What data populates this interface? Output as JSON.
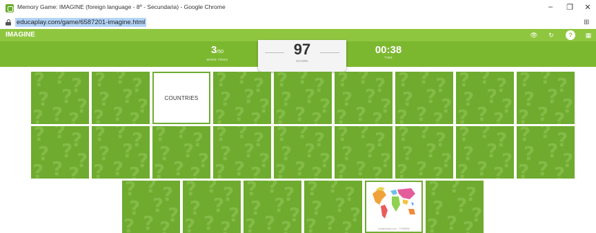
{
  "window": {
    "title": "Memory Game: IMAGINE (foreign language - 8º - Secundaria) - Google Chrome",
    "controls": {
      "minimize": "–",
      "restore": "❐",
      "close": "✕"
    }
  },
  "address_bar": {
    "url": "educaplay.com/game/6587201-imagine.html"
  },
  "game": {
    "title": "IMAGINE",
    "stats": {
      "more_tries_value": "3",
      "more_tries_total": "/50",
      "more_tries_label": "MORE TRIES",
      "score_value": "97",
      "score_label": "SCORE",
      "time_value": "00:38",
      "time_label": "TIME"
    },
    "header_icons": [
      "eye-icon",
      "restart-icon",
      "help-icon",
      "grid-icon"
    ]
  },
  "cards": {
    "face_down_mark": "?",
    "revealed_text": "COUNTRIES",
    "map_caption": "shutterstock.com · 77695636"
  },
  "colors": {
    "header_green": "#8fc63f",
    "stats_green": "#7cb82f",
    "card_green": "#6eab2f",
    "card_pattern": "#84bb47"
  }
}
